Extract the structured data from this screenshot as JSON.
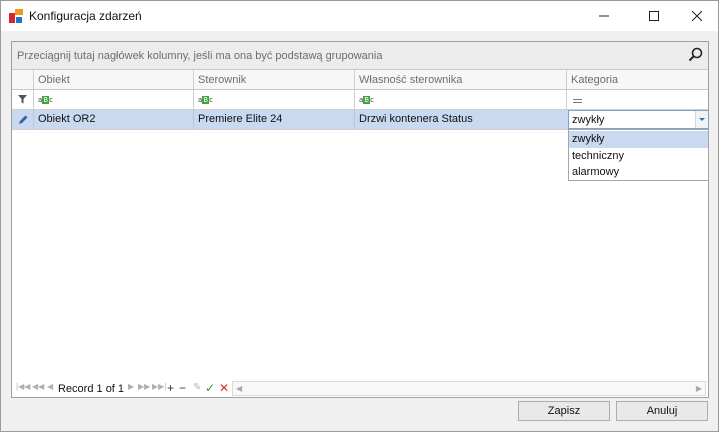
{
  "window": {
    "title": "Konfiguracja zdarzeń",
    "accent_color": "#d83b01"
  },
  "grid": {
    "group_panel_hint": "Przeciągnij tutaj nagłówek kolumny, jeśli ma ona być podstawą grupowania",
    "columns": [
      "Obiekt",
      "Sterownik",
      "Własność sterownika",
      "Kategoria"
    ],
    "filter_icon": "funnel-icon",
    "rows": [
      {
        "indicator": "pencil-icon",
        "cells": [
          "Obiekt OR2",
          "Premiere Elite 24",
          "Drzwi kontenera Status",
          "zwykły"
        ]
      }
    ],
    "row_highlight_color": "#c9d9f0"
  },
  "category_editor": {
    "value": "zwykły",
    "options": [
      "zwykły",
      "techniczny",
      "alarmowy"
    ],
    "selected_option": "zwykły"
  },
  "navigator": {
    "record_text": "Record 1 of 1"
  },
  "buttons": {
    "save": "Zapisz",
    "cancel": "Anuluj"
  }
}
